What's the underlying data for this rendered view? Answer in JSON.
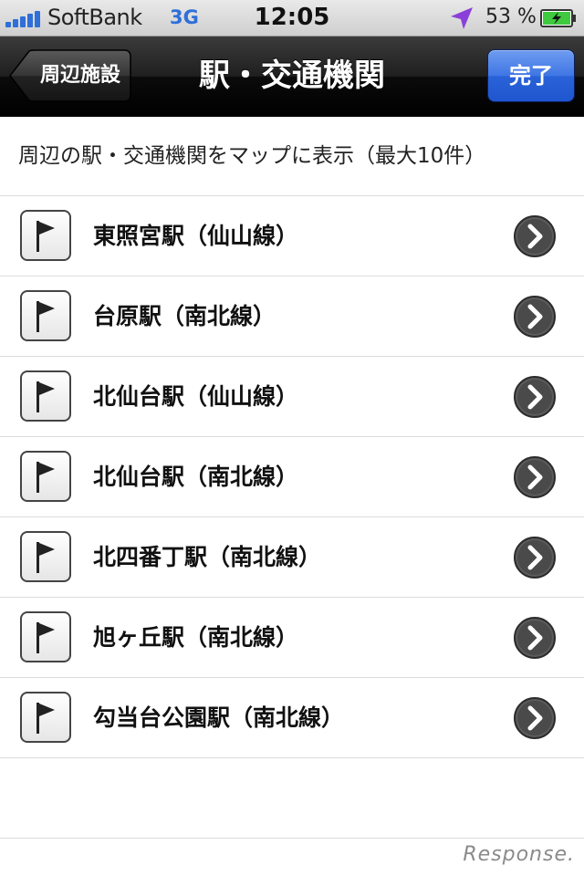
{
  "status_bar": {
    "carrier": "SoftBank",
    "network": "3G",
    "time": "12:05",
    "battery_percent": "53 %",
    "icons": [
      "signal-icon",
      "location-arrow-icon",
      "battery-charging-icon"
    ],
    "colors": {
      "signal": "#2f6fd8",
      "location": "#8a3fd8",
      "battery": "#3ec93e"
    }
  },
  "nav_bar": {
    "back_label": "周辺施設",
    "title": "駅・交通機関",
    "done_label": "完了",
    "colors": {
      "done_button": "#2a62d8"
    }
  },
  "header": {
    "text": "周辺の駅・交通機関をマップに表示（最大10件）"
  },
  "stations": [
    {
      "label": "東照宮駅（仙山線）",
      "icon": "flag-icon"
    },
    {
      "label": "台原駅（南北線）",
      "icon": "flag-icon"
    },
    {
      "label": "北仙台駅（仙山線）",
      "icon": "flag-icon"
    },
    {
      "label": "北仙台駅（南北線）",
      "icon": "flag-icon"
    },
    {
      "label": "北四番丁駅（南北線）",
      "icon": "flag-icon"
    },
    {
      "label": "旭ヶ丘駅（南北線）",
      "icon": "flag-icon"
    },
    {
      "label": "勾当台公園駅（南北線）",
      "icon": "flag-icon"
    }
  ],
  "watermark": "Response."
}
